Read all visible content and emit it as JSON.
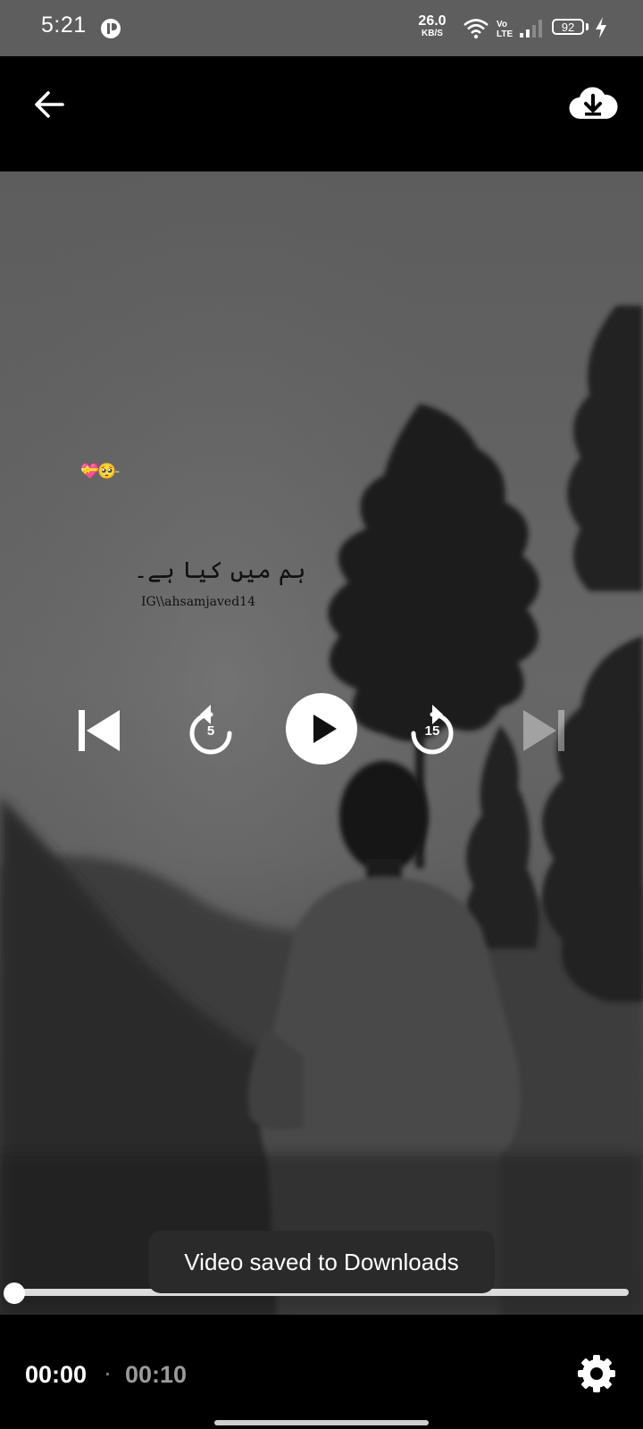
{
  "status_bar": {
    "time": "5:21",
    "net_speed_value": "26.0",
    "net_speed_unit": "KB/S",
    "battery_level": "92",
    "icons": [
      "app-notification-icon",
      "wifi-icon",
      "volte-icon",
      "signal-icon",
      "battery-icon",
      "charging-icon"
    ]
  },
  "app_bar": {
    "back_icon": "arrow-left-icon",
    "download_icon": "cloud-download-icon"
  },
  "video": {
    "overlay_emoji": "💝🥺‐",
    "overlay_text": "ہم میں کیا ہے۔",
    "overlay_handle": "IG\\\\ahsamjaved14"
  },
  "controls": {
    "previous_icon": "skip-previous-icon",
    "rewind_seconds": "5",
    "play_icon": "play-icon",
    "forward_seconds": "15",
    "next_icon": "skip-next-icon",
    "next_enabled": false
  },
  "toast": {
    "message": "Video saved to Downloads"
  },
  "playback": {
    "current_time": "00:00",
    "separator": "·",
    "total_time": "00:10",
    "progress": 0
  },
  "bottom_bar": {
    "settings_icon": "gear-icon"
  }
}
